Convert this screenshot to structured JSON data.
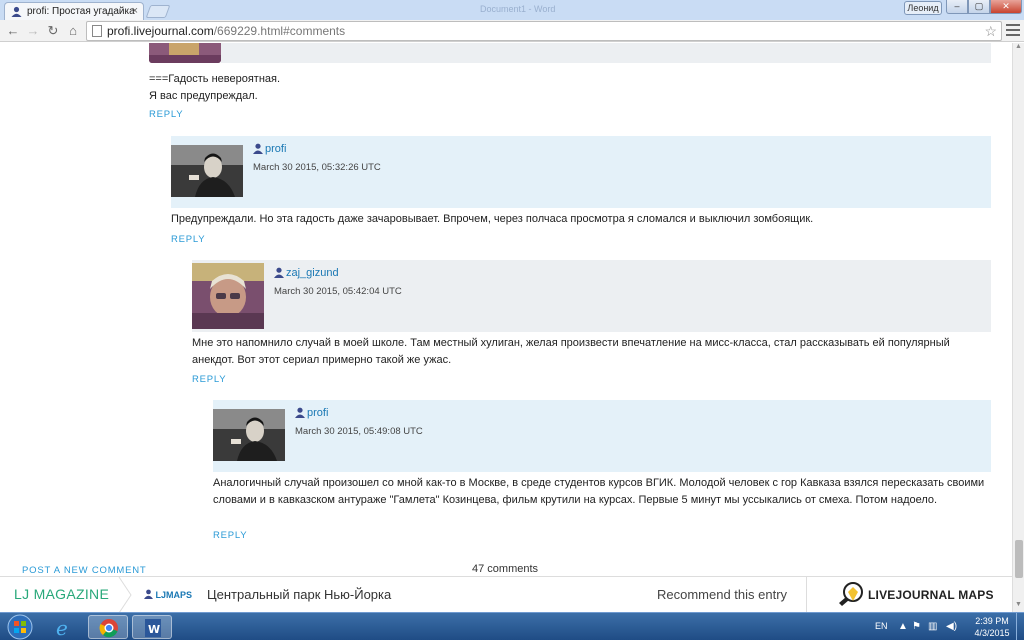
{
  "browser": {
    "tab_title": "profi: Простая угадайка",
    "ghost_title": "Document1 - Word",
    "user_badge": "Леонид",
    "url_host": "profi.livejournal.com",
    "url_path": "/669229.html#comments",
    "icons": [
      "back-icon",
      "forward-icon",
      "reload-icon",
      "home-icon",
      "page-icon",
      "star-icon",
      "menu-icon"
    ]
  },
  "window_controls": {
    "minimize": "–",
    "maximize": "▢",
    "close": "✕"
  },
  "thread": {
    "top_comment": {
      "lines": [
        "===Гадость невероятная.",
        "Я вас предупреждал."
      ],
      "reply": "REPLY"
    },
    "comments": [
      {
        "author": "profi",
        "date": "March 30 2015, 05:32:26 UTC",
        "text": "Предупреждали. Но эта гадость даже зачаровывает. Впрочем, через полчаса просмотра я сломался и выключил зомбоящик.",
        "reply": "REPLY"
      },
      {
        "author": "zaj_gizund",
        "date": "March 30 2015, 05:42:04 UTC",
        "text": "Мне это напомнило случай в моей школе. Там местный хулиган, желая произвести впечатление на мисс-класса, стал рассказывать ей популярный анекдот. Вот этот сериал примерно такой же ужас.",
        "reply": "REPLY"
      },
      {
        "author": "profi",
        "date": "March 30 2015, 05:49:08 UTC",
        "text": "Аналогичный случай произошел со мной как-то в Москве, в среде студентов курсов ВГИК. Молодой человек с гор Кавказа взялся пересказать своими словами и в кавказском антураже \"Гамлета\" Козинцева, фильм крутили на курсах. Первые 5 минут мы уссыкались от смеха. Потом надоело.",
        "reply": "REPLY"
      }
    ],
    "post_new": "POST A NEW COMMENT",
    "count": "47 comments"
  },
  "ljbar": {
    "magazine": "LJ MAGAZINE",
    "maps_user": "LJMAPS",
    "maps_title": "Центральный парк Нью-Йорка",
    "recommend": "Recommend this entry",
    "logo_text": "LIVEJOURNAL MAPS"
  },
  "taskbar": {
    "apps": [
      "start",
      "internet-explorer",
      "chrome",
      "word"
    ],
    "language": "EN",
    "time": "2:39 PM",
    "date": "4/3/2015"
  },
  "colors": {
    "link": "#1a78b4",
    "reply": "#2a9ad6",
    "comment_head_blue": "#e4f1f9",
    "comment_head_gray": "#eceff2",
    "lj_green": "#28a87a"
  }
}
